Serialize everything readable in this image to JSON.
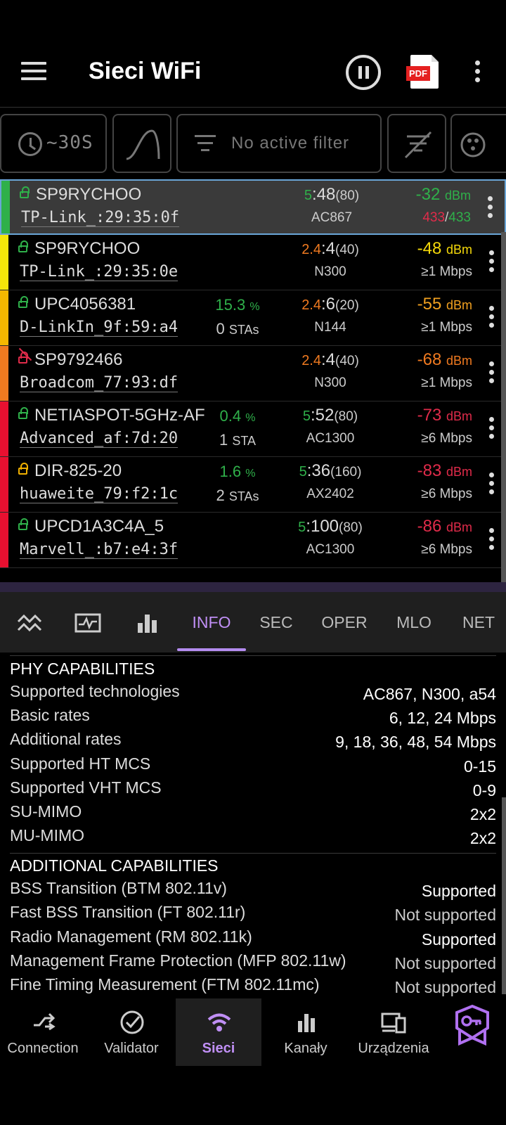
{
  "app": {
    "title": "Sieci WiFi",
    "pdf_label": "PDF"
  },
  "filterbar": {
    "time_label": "~30S",
    "filter_label": "No active filter"
  },
  "networks": [
    {
      "ssid": "SP9RYCHOO",
      "vendor": "TP-Link_:29:35:0f",
      "util": "",
      "util_unit": "",
      "stas": "",
      "stas_unit": "",
      "band": "5",
      "channel": ":48",
      "width": "(80)",
      "standard": "AC867",
      "signal": "-32",
      "signal_unit": "dBm",
      "signal_color": "#2fb04a",
      "rate_a": "433",
      "rate_sep": "/",
      "rate_b": "433",
      "rate_unit": "",
      "strip_color": "#2fb04a",
      "lock": "green",
      "selected": true
    },
    {
      "ssid": "SP9RYCHOO",
      "vendor": "TP-Link_:29:35:0e",
      "util": "",
      "util_unit": "",
      "stas": "",
      "stas_unit": "",
      "band": "2.4",
      "channel": ":4",
      "width": "(40)",
      "standard": "N300",
      "signal": "-48",
      "signal_unit": "dBm",
      "signal_color": "#f5d90a",
      "rate_text": "≥1 Mbps",
      "strip_color": "#f5e60a",
      "lock": "green",
      "selected": false
    },
    {
      "ssid": "UPC4056381",
      "vendor": "D-LinkIn_9f:59:a4",
      "util": "15.3",
      "util_unit": "%",
      "stas": "0",
      "stas_unit": "STAs",
      "band": "2.4",
      "channel": ":6",
      "width": "(20)",
      "standard": "N144",
      "signal": "-55",
      "signal_unit": "dBm",
      "signal_color": "#f0a020",
      "rate_text": "≥1 Mbps",
      "strip_color": "#f5b800",
      "lock": "green",
      "selected": false
    },
    {
      "ssid": "SP9792466",
      "vendor": "Broadcom_77:93:df",
      "util": "",
      "util_unit": "",
      "stas": "",
      "stas_unit": "",
      "band": "2.4",
      "channel": ":4",
      "width": "(40)",
      "standard": "N300",
      "signal": "-68",
      "signal_unit": "dBm",
      "signal_color": "#f07a20",
      "rate_text": "≥1 Mbps",
      "strip_color": "#f07a20",
      "lock": "open",
      "selected": false
    },
    {
      "ssid": "NETIASPOT-5GHz-AF",
      "vendor": "Advanced_af:7d:20",
      "util": "0.4",
      "util_unit": "%",
      "stas": "1",
      "stas_unit": "STA",
      "band": "5",
      "channel": ":52",
      "width": "(80)",
      "standard": "AC1300",
      "signal": "-73",
      "signal_unit": "dBm",
      "signal_color": "#e02b4a",
      "rate_text": "≥6 Mbps",
      "strip_color": "#e81030",
      "lock": "green",
      "selected": false
    },
    {
      "ssid": "DIR-825-20",
      "vendor": "huaweite_79:f2:1c",
      "util": "1.6",
      "util_unit": "%",
      "stas": "2",
      "stas_unit": "STAs",
      "band": "5",
      "channel": ":36",
      "width": "(160)",
      "standard": "AX2402",
      "signal": "-83",
      "signal_unit": "dBm",
      "signal_color": "#e02b4a",
      "rate_text": "≥6 Mbps",
      "strip_color": "#e81030",
      "lock": "yellow",
      "selected": false
    },
    {
      "ssid": "UPCD1A3C4A_5",
      "vendor": "Marvell_:b7:e4:3f",
      "util": "",
      "util_unit": "",
      "stas": "",
      "stas_unit": "",
      "band": "5",
      "channel": ":100",
      "width": "(80)",
      "standard": "AC1300",
      "signal": "-86",
      "signal_unit": "dBm",
      "signal_color": "#e02b4a",
      "rate_text": "≥6 Mbps",
      "strip_color": "#e81030",
      "lock": "green",
      "selected": false
    }
  ],
  "tabs": {
    "info": "INFO",
    "sec": "SEC",
    "oper": "OPER",
    "mlo": "MLO",
    "net": "NET"
  },
  "phy": {
    "title": "PHY CAPABILITIES",
    "rows": [
      {
        "label": "Supported technologies",
        "value": "AC867, N300, a54"
      },
      {
        "label": "Basic rates",
        "value": "6, 12, 24 Mbps"
      },
      {
        "label": "Additional rates",
        "value": "9, 18, 36, 48, 54 Mbps"
      },
      {
        "label": "Supported HT MCS",
        "value": "0-15"
      },
      {
        "label": "Supported VHT MCS",
        "value": "0-9"
      },
      {
        "label": "SU-MIMO",
        "value": "2x2"
      },
      {
        "label": "MU-MIMO",
        "value": "2x2"
      }
    ]
  },
  "additional": {
    "title": "ADDITIONAL CAPABILITIES",
    "rows": [
      {
        "label": "BSS Transition (BTM 802.11v)",
        "value": "Supported"
      },
      {
        "label": "Fast BSS Transition (FT 802.11r)",
        "value": "Not supported"
      },
      {
        "label": "Radio Management (RM 802.11k)",
        "value": "Supported"
      },
      {
        "label": "Management Frame Protection (MFP 802.11w)",
        "value": "Not supported"
      },
      {
        "label": "Fine Timing Measurement (FTM 802.11mc)",
        "value": "Not supported"
      }
    ]
  },
  "bottomnav": {
    "connection": "Connection",
    "validator": "Validator",
    "sieci": "Sieci",
    "kanaly": "Kanały",
    "urzadzenia": "Urządzenia"
  },
  "colors": {
    "accent": "#c08ff5",
    "selected_border": "#6aa6d8"
  }
}
